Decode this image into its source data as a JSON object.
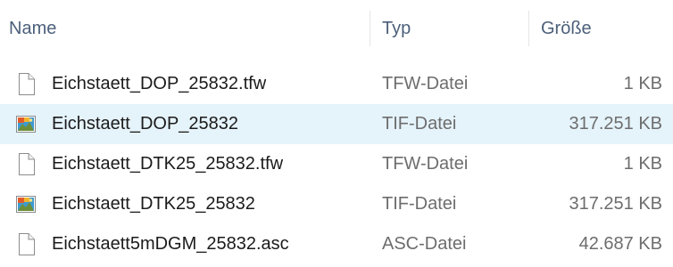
{
  "header": {
    "name_label": "Name",
    "type_label": "Typ",
    "size_label": "Größe"
  },
  "files": [
    {
      "name": "Eichstaett_DOP_25832.tfw",
      "type": "TFW-Datei",
      "size": "1 KB",
      "icon": "document-icon",
      "selected": false
    },
    {
      "name": "Eichstaett_DOP_25832",
      "type": "TIF-Datei",
      "size": "317.251 KB",
      "icon": "image-file-icon",
      "selected": true
    },
    {
      "name": "Eichstaett_DTK25_25832.tfw",
      "type": "TFW-Datei",
      "size": "1 KB",
      "icon": "document-icon",
      "selected": false
    },
    {
      "name": "Eichstaett_DTK25_25832",
      "type": "TIF-Datei",
      "size": "317.251 KB",
      "icon": "image-file-icon",
      "selected": false
    },
    {
      "name": "Eichstaett5mDGM_25832.asc",
      "type": "ASC-Datei",
      "size": "42.687 KB",
      "icon": "document-icon",
      "selected": false
    }
  ],
  "colors": {
    "selection": "#e5f3fb",
    "header_text": "#4c607a",
    "secondary_text": "#6d6d6d"
  }
}
